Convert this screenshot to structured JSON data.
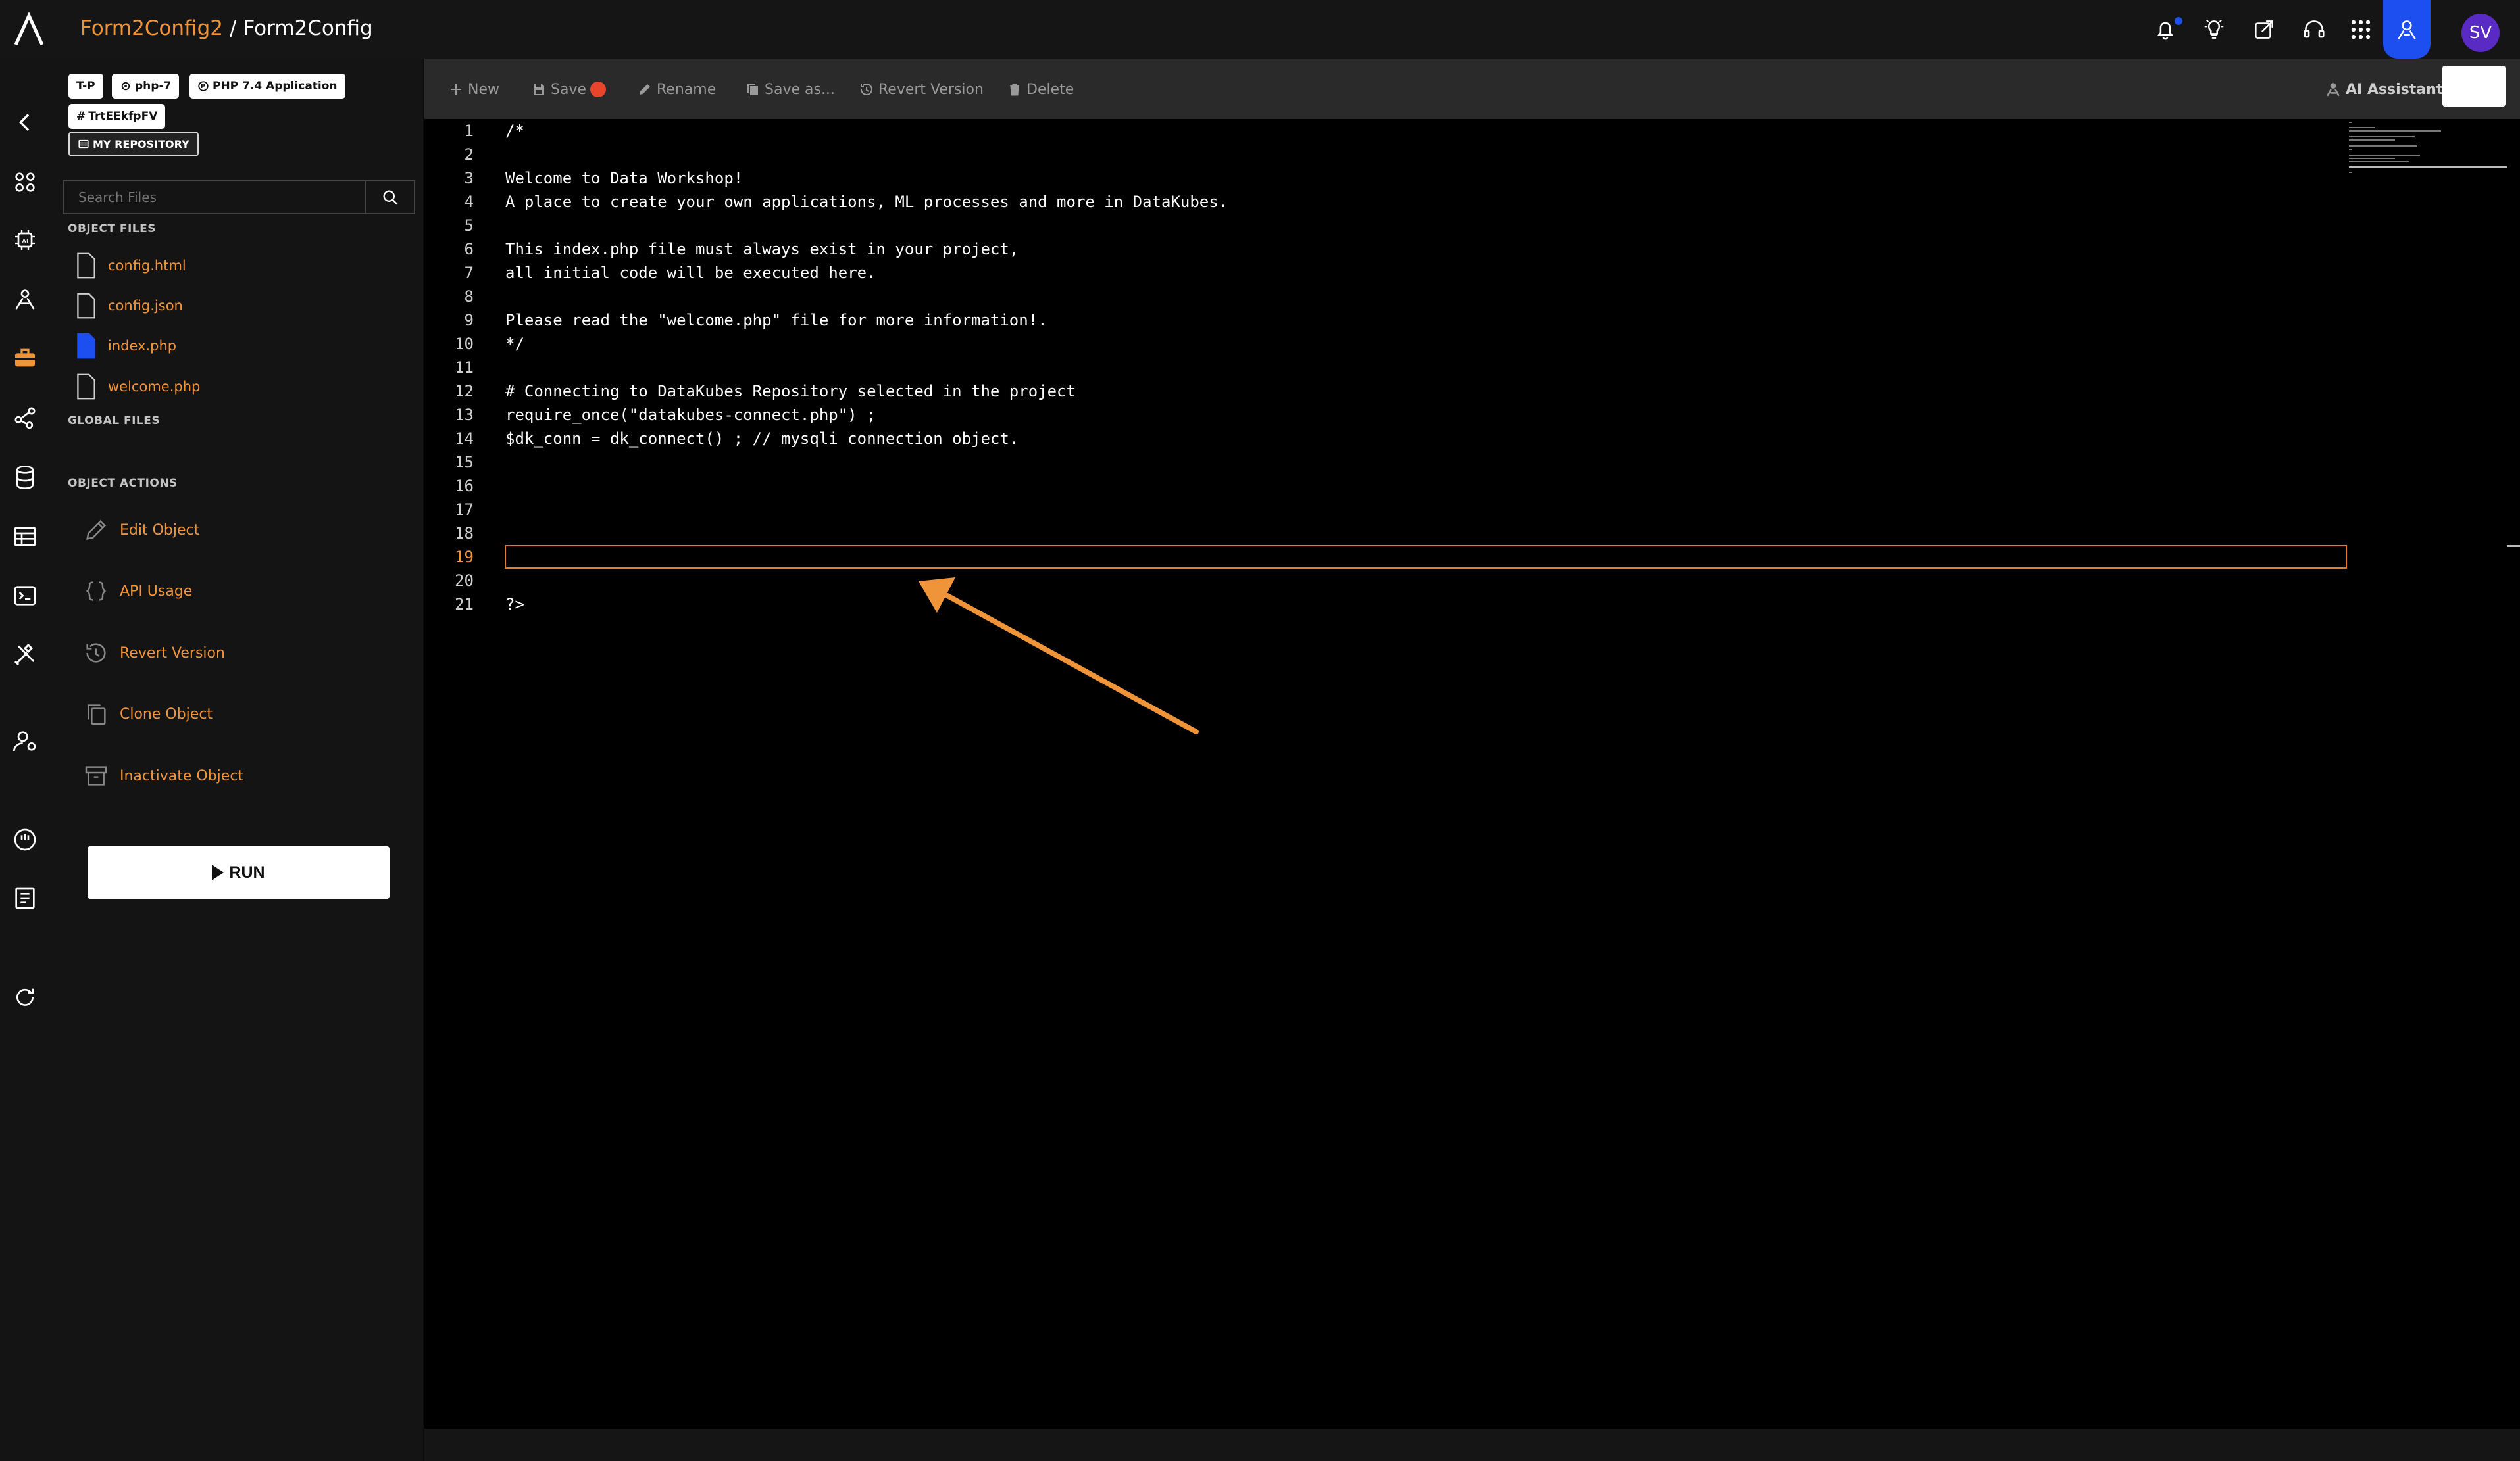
{
  "breadcrumb": {
    "project": "Form2Config2",
    "separator": "/",
    "file": "Form2Config"
  },
  "header": {
    "icons": [
      "bell-icon",
      "lightbulb-icon",
      "share-icon",
      "headset-icon",
      "apps-grid-icon",
      "agent-icon"
    ],
    "avatar": "SV"
  },
  "rail": {
    "icons": [
      "back-icon",
      "dashboard-icon",
      "ai-chip-icon",
      "ml-icon",
      "workshop-icon",
      "flow-icon",
      "database-icon",
      "table-icon",
      "terminal-icon",
      "tools-icon",
      "user-settings-icon",
      "dial-icon",
      "book-icon",
      "refresh-icon"
    ]
  },
  "tags": {
    "t1": "T-P",
    "t2": "php-7",
    "t3": "PHP 7.4 Application",
    "t4": "TrtEEkfpFV",
    "repo": "MY REPOSITORY"
  },
  "search": {
    "placeholder": "Search Files"
  },
  "sections": {
    "object_files": "OBJECT FILES",
    "global_files": "GLOBAL FILES",
    "object_actions": "OBJECT ACTIONS"
  },
  "files": [
    "config.html",
    "config.json",
    "index.php",
    "welcome.php"
  ],
  "active_file": "index.php",
  "actions": [
    "Edit Object",
    "API Usage",
    "Revert Version",
    "Clone Object",
    "Inactivate Object"
  ],
  "run_label": "RUN",
  "toolbar": {
    "new": "New",
    "save": "Save",
    "rename": "Rename",
    "save_as": "Save as...",
    "revert": "Revert Version",
    "delete": "Delete",
    "ai": "AI Assistant"
  },
  "colors": {
    "accent": "#f0943a",
    "save_dot": "#e8452c",
    "agent_blue": "#1d4ff0",
    "avatar": "#5a2bc4"
  },
  "code": {
    "active_line": 19,
    "lines": [
      "/*",
      "",
      "Welcome to Data Workshop!",
      "A place to create your own applications, ML processes and more in DataKubes.",
      "",
      "This index.php file must always exist in your project,",
      "all initial code will be executed here.",
      "",
      "Please read the \"welcome.php\" file for more information!.",
      "*/",
      "",
      "# Connecting to DataKubes Repository selected in the project",
      "require_once(\"datakubes-connect.php\") ;",
      "$dk_conn = dk_connect() ; // mysqli connection object.",
      "",
      "",
      "",
      "",
      "",
      "",
      "?>"
    ]
  }
}
